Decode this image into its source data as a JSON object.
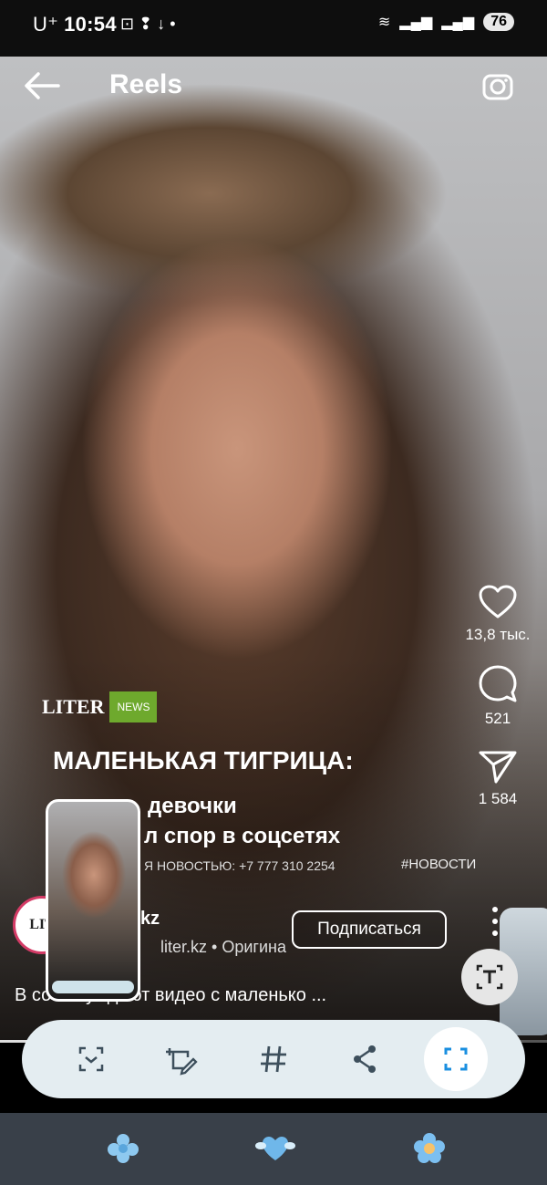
{
  "status_bar": {
    "carrier": "U⁺",
    "time": "10:54",
    "battery": "76"
  },
  "header": {
    "title": "Reels"
  },
  "overlay": {
    "logo_liter": "LITER",
    "logo_news": "NEWS",
    "headline": "МАЛЕНЬКАЯ ТИГРИЦА:",
    "sub_line_1": "девочки",
    "sub_line_2": "л спор в соцсетях",
    "contact": "Я НОВОСТЬЮ: +7 777 310 2254",
    "hashtag": "#НОВОСТИ"
  },
  "actions": {
    "likes": "13,8 тыс.",
    "comments": "521",
    "shares": "1 584"
  },
  "post": {
    "avatar_text": "LIT",
    "username": "kz",
    "subline": "liter.kz • Оригина",
    "follow_label": "Подписаться",
    "caption": "В со          обсуждают видео с маленько ..."
  },
  "progress": {
    "fraction": 0.06
  },
  "dock": {
    "icons": [
      "scan-icon",
      "add-note-icon",
      "hashtag-icon",
      "share-icon",
      "screenshot-select-icon"
    ],
    "accent": "#1a8fe0"
  },
  "colors": {
    "like_ring": "#d43b66",
    "news_green": "#6ea92d"
  }
}
